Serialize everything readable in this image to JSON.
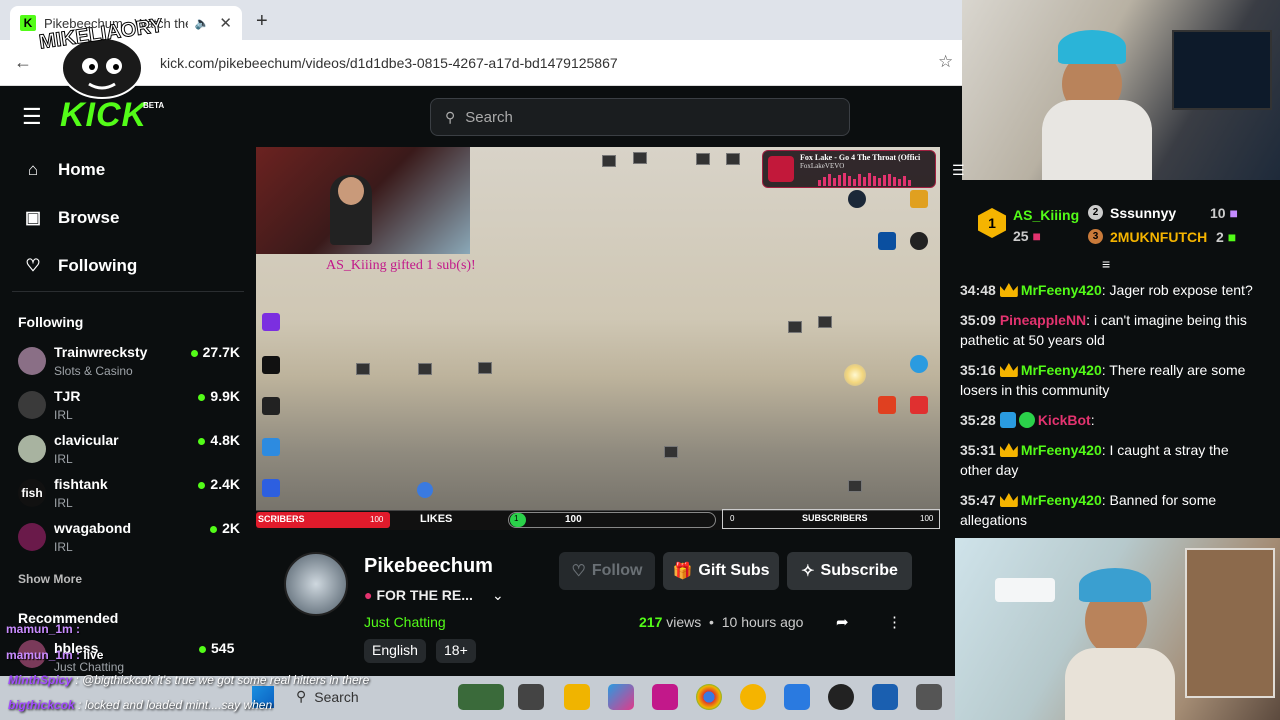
{
  "browser": {
    "tab_title": "Pikebeechum - Watch the V",
    "tab_favicon": "K",
    "new_tab": "+",
    "url": "kick.com/pikebeechum/videos/d1d1dbe3-0815-4267-a17d-bd1479125867",
    "overlay_logo_text": "MIKELIAORY"
  },
  "header": {
    "logo": "KICK",
    "beta": "BETA",
    "search_placeholder": "Search"
  },
  "sidebar": {
    "nav": [
      {
        "label": "Home",
        "icon": "home-icon"
      },
      {
        "label": "Browse",
        "icon": "browse-icon"
      },
      {
        "label": "Following",
        "icon": "heart-icon"
      }
    ],
    "following_heading": "Following",
    "channels": [
      {
        "name": "Trainwrecksty",
        "category": "Slots & Casino",
        "viewers": "27.7K",
        "color": "#8a6f86"
      },
      {
        "name": "TJR",
        "category": "IRL",
        "viewers": "9.9K",
        "color": "#3a3a3a"
      },
      {
        "name": "clavicular",
        "category": "IRL",
        "viewers": "4.8K",
        "color": "#a8b3a0"
      },
      {
        "name": "fishtank",
        "category": "IRL",
        "viewers": "2.4K",
        "color": "#111111"
      },
      {
        "name": "wvagabond",
        "category": "IRL",
        "viewers": "2K",
        "color": "#6a1a4a"
      }
    ],
    "show_more": "Show More",
    "recommended_heading": "Recommended",
    "recommended": {
      "name": "bbless",
      "category": "Just Chatting",
      "viewers": "545"
    }
  },
  "video": {
    "gift_message": "AS_Kiiing gifted 1 sub(s)!",
    "now_playing_title": "Fox Lake - Go 4 The Throat (Offici",
    "now_playing_artist": "FoxLakeVEVO",
    "subs_left_label": "SCRIBERS",
    "subs_left_value": "100",
    "likes_label": "LIKES",
    "likes_current": "1",
    "likes_goal": "100",
    "subs_right_start": "0",
    "subs_right_label": "SUBSCRIBERS",
    "subs_right_goal": "100"
  },
  "channel": {
    "name": "Pikebeechum",
    "title": "FOR THE RE...",
    "category": "Just Chatting",
    "tags": [
      "English",
      "18+"
    ],
    "follow_label": "Follow",
    "gift_label": "Gift Subs",
    "subscribe_label": "Subscribe",
    "views_count": "217",
    "views_word": "views",
    "time_ago": "10 hours ago"
  },
  "chat": {
    "leaderboard": {
      "first": {
        "rank": "1",
        "name": "AS_Kiiing",
        "count": "25"
      },
      "second": {
        "rank": "2",
        "name": "Sssunnyy",
        "count": "10"
      },
      "third": {
        "rank": "3",
        "name": "2MUKNFUTCH",
        "count": "2"
      }
    },
    "messages": [
      {
        "time": "34:48",
        "user": "MrFeeny420",
        "color": "#53fc18",
        "text": "Jager rob expose tent?"
      },
      {
        "time": "35:09",
        "user": "PineappleNN",
        "color": "#e3336f",
        "text": "i can't imagine being this pathetic at 50 years old"
      },
      {
        "time": "35:16",
        "user": "MrFeeny420",
        "color": "#53fc18",
        "text": "There really are some losers in this community"
      },
      {
        "time": "35:28",
        "user": "KickBot",
        "color": "#e3336f",
        "text": ""
      },
      {
        "time": "35:31",
        "user": "MrFeeny420",
        "color": "#53fc18",
        "text": "I caught a stray the other day"
      },
      {
        "time": "35:47",
        "user": "MrFeeny420",
        "color": "#53fc18",
        "text": "Banned for some allegations"
      }
    ]
  },
  "overlay_chat": {
    "mamun1": "mamun_1m :",
    "mamun2_user": "mamun_1m :",
    "mamun2_text": "live",
    "line1_user": "MinthSpicy",
    "line1_text": ": @bigthickcok it's true we got some real hitters in there",
    "line2_user": "bigthickcok",
    "line2_text": ": locked and loaded mint....say when"
  },
  "taskbar": {
    "search": "Search"
  }
}
